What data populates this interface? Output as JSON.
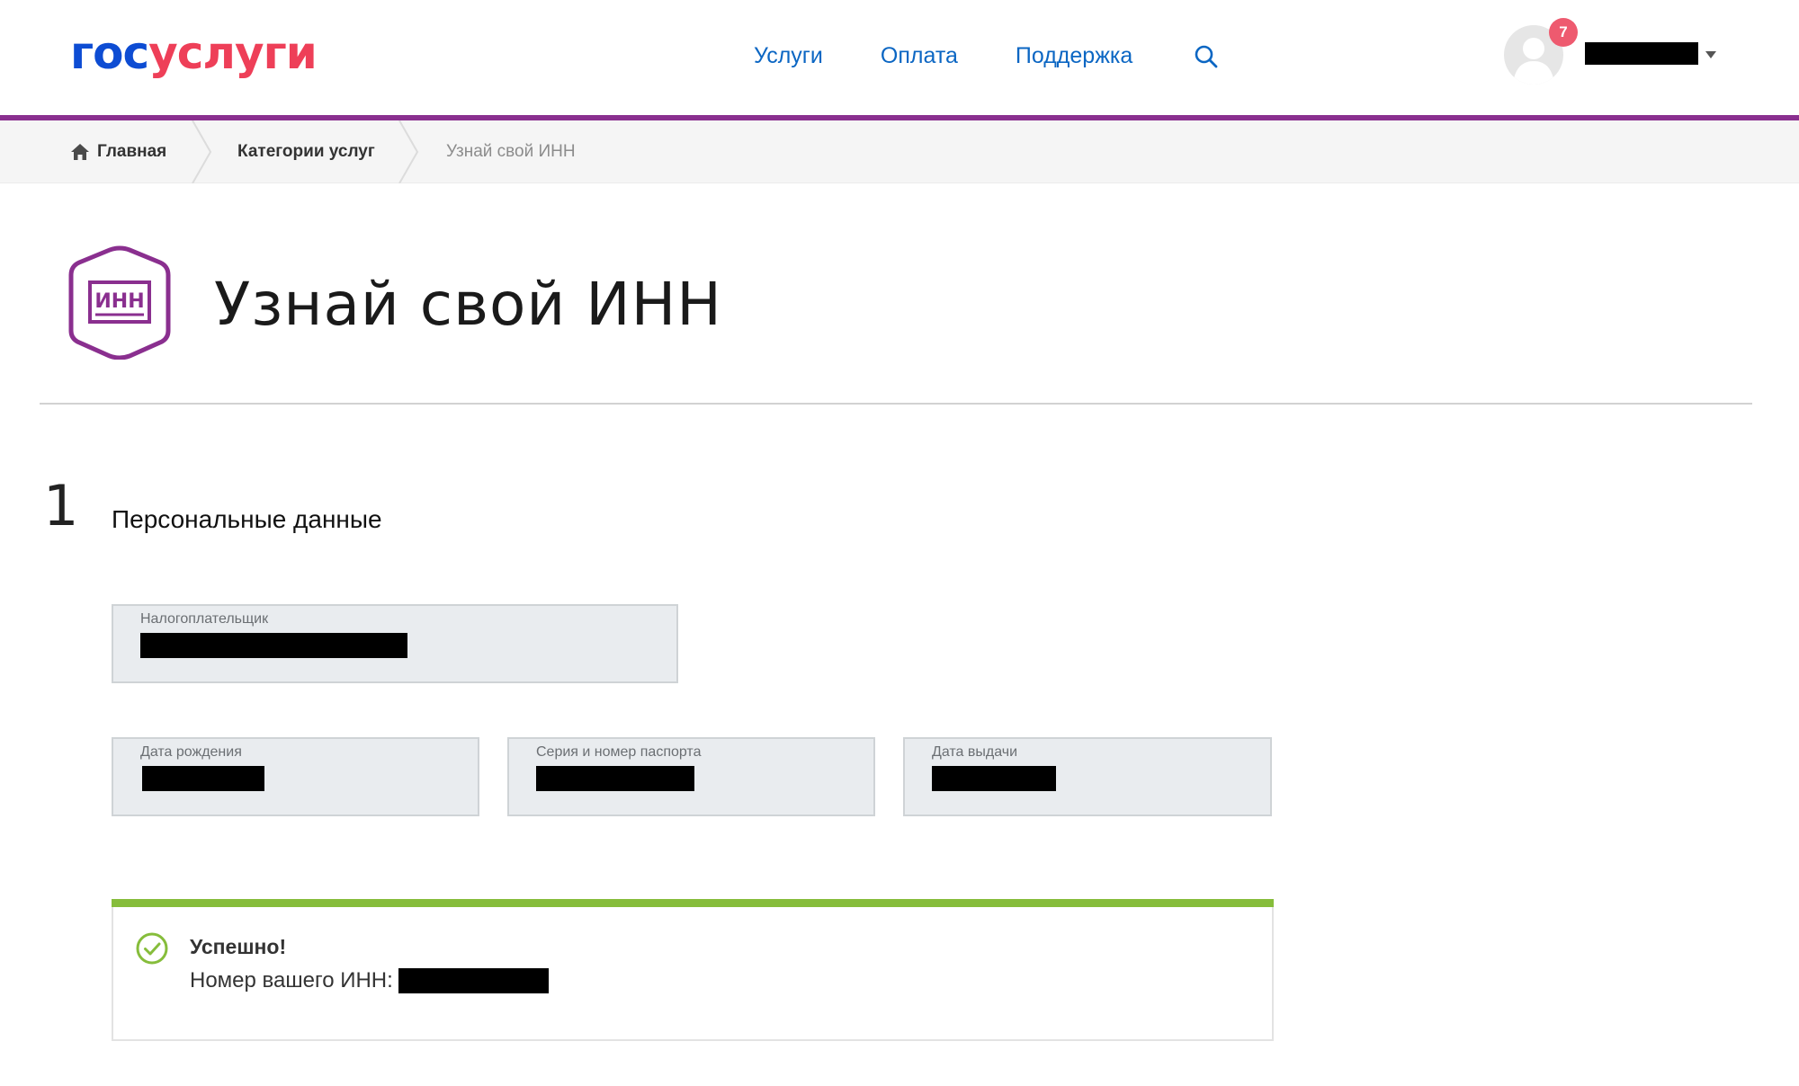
{
  "header": {
    "logo_part1": "гос",
    "logo_part2": "услуги",
    "nav": [
      "Услуги",
      "Оплата",
      "Поддержка"
    ],
    "notifications_count": "7",
    "accent_color": "#8a2f8f",
    "logo_colors": [
      "#0d4cd3",
      "#ee3f58"
    ]
  },
  "breadcrumb": {
    "home": "Главная",
    "categories": "Категории услуг",
    "current": "Узнай свой ИНН"
  },
  "page": {
    "icon_text": "ИНН",
    "title": "Узнай свой ИНН"
  },
  "step": {
    "number": "1",
    "title": "Персональные данные"
  },
  "fields": {
    "taxpayer_label": "Налогоплательщик",
    "birth_date_label": "Дата рождения",
    "passport_label": "Серия и номер паспорта",
    "issue_date_label": "Дата выдачи"
  },
  "success": {
    "title": "Успешно!",
    "text": "Номер вашего ИНН:",
    "color": "#86bd3b"
  }
}
